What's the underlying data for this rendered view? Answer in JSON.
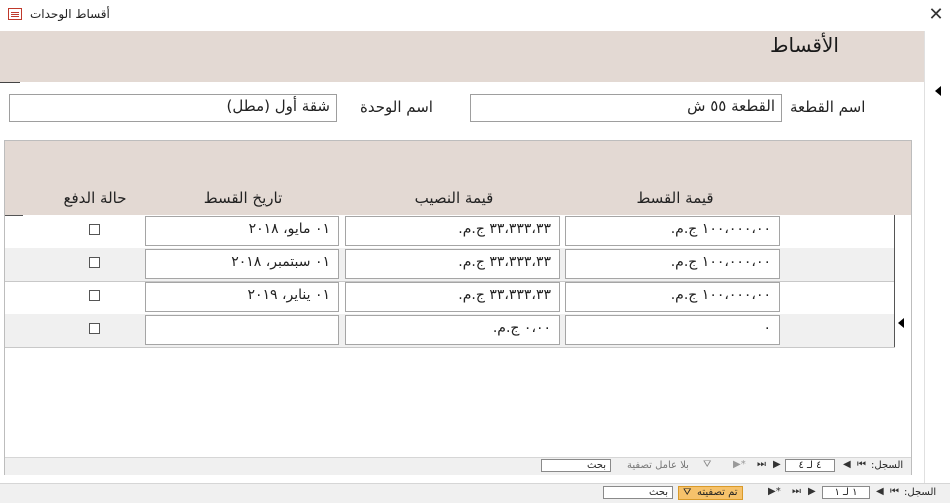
{
  "window": {
    "title": "أقساط الوحدات",
    "close": "✕"
  },
  "form": {
    "heading": "الأقساط",
    "plot_label": "اسم القطعة",
    "plot_value": "القطعة ٥٥ ش",
    "unit_label": "اسم الوحدة",
    "unit_value": "شقة أول (مطل)"
  },
  "subform": {
    "columns": {
      "installment_value": "قيمة القسط",
      "share_value": "قيمة النصيب",
      "installment_date": "تاريخ القسط",
      "payment_status": "حالة الدفع"
    },
    "rows": [
      {
        "installment_value": "١٠٠،٠٠٠،٠٠ ج.م.",
        "share_value": "٣٣،٣٣٣،٣٣ ج.م.",
        "installment_date": "٠١ مايو، ٢٠١٨",
        "paid": false
      },
      {
        "installment_value": "١٠٠،٠٠٠،٠٠ ج.م.",
        "share_value": "٣٣،٣٣٣،٣٣ ج.م.",
        "installment_date": "٠١ سبتمبر، ٢٠١٨",
        "paid": false
      },
      {
        "installment_value": "١٠٠،٠٠٠،٠٠ ج.م.",
        "share_value": "٣٣،٣٣٣،٣٣ ج.م.",
        "installment_date": "٠١ يناير، ٢٠١٩",
        "paid": false
      },
      {
        "installment_value": "٠",
        "share_value": "٠،٠٠ ج.م.",
        "installment_date": "",
        "paid": false
      }
    ],
    "nav": {
      "record_label": "السجل:",
      "record_value": "٤ لـ ٤",
      "filter_label": "بلا عامل تصفية",
      "search_placeholder": "بحث"
    }
  },
  "main_nav": {
    "record_label": "السجل:",
    "record_value": "١ لـ ١",
    "filter_label": "تم تصفيته",
    "search_placeholder": "بحث"
  },
  "colors": {
    "header_band": "#e3d9d3",
    "filter_badge": "#f6c26b"
  }
}
